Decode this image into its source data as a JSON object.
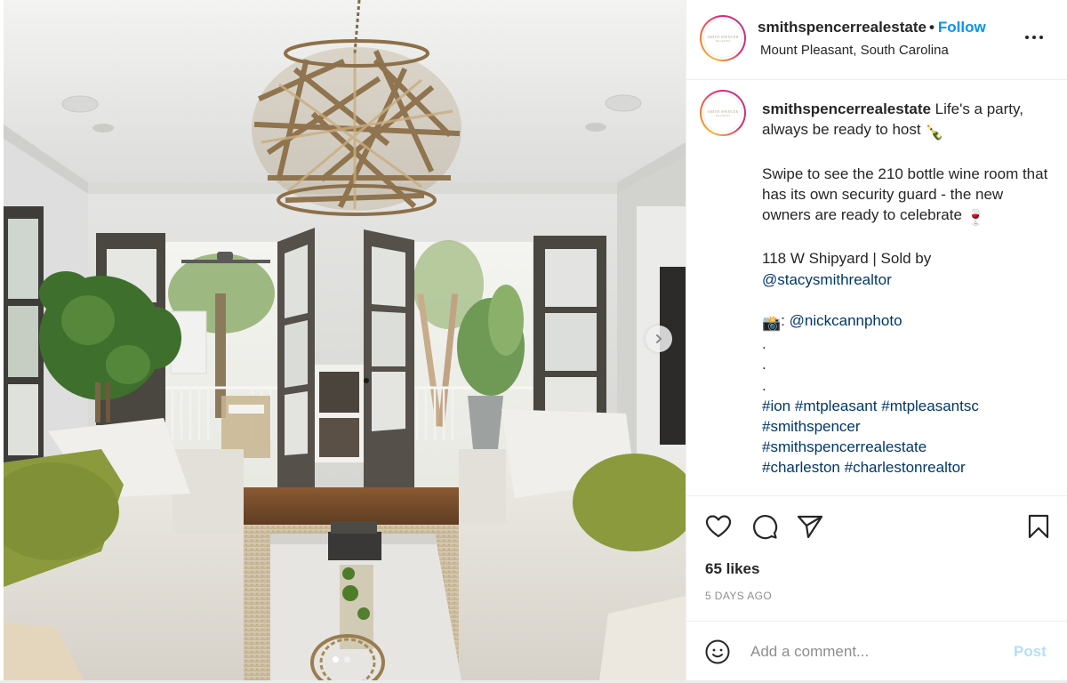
{
  "post": {
    "account": {
      "username": "smithspencerrealestate",
      "location": "Mount Pleasant, South Carolina",
      "follow_label": "Follow",
      "separator": "•",
      "avatar_logo_line1": "SMITH SPENCER",
      "avatar_logo_line2": "REAL ESTATE"
    },
    "media": {
      "description": "Living room with chandelier, white sofas with green bolster pillows, marble coffee table, open French doors to a porch",
      "carousel_total": 2,
      "carousel_active_index": 0,
      "next_icon": "chevron-right-icon"
    },
    "caption": {
      "username": "smithspencerrealestate",
      "line1": " Life's a party, always be ready to host ",
      "emoji1": "🍾",
      "para2": "Swipe to see the 210 bottle wine room that has its own security guard - the new owners are ready to celebrate ",
      "emoji2": "🍷",
      "para3_text": "118 W Shipyard | Sold by ",
      "mention1": "@stacysmithrealtor",
      "camera_emoji": "📸",
      "camera_sep": ": ",
      "mention2": "@nickcannphoto",
      "dots": [
        ".",
        ".",
        "."
      ],
      "hashtags": [
        "#ion",
        "#mtpleasant",
        "#mtpleasantsc",
        "#smithspencer",
        "#smithspencerrealestate",
        "#charleston",
        "#charlestonrealtor"
      ]
    },
    "actions": {
      "like_icon": "heart-icon",
      "comment_icon": "comment-icon",
      "share_icon": "paper-plane-icon",
      "save_icon": "bookmark-icon"
    },
    "likes_label": "65 likes",
    "timestamp": "5 DAYS AGO",
    "comment_box": {
      "placeholder": "Add a comment...",
      "value": "",
      "post_label": "Post",
      "emoji_icon": "smiley-icon"
    },
    "colors": {
      "follow_blue": "#0095f6",
      "link_navy": "#00376b",
      "post_disabled": "#b2dffc",
      "muted_gray": "#8e8e8e"
    }
  }
}
